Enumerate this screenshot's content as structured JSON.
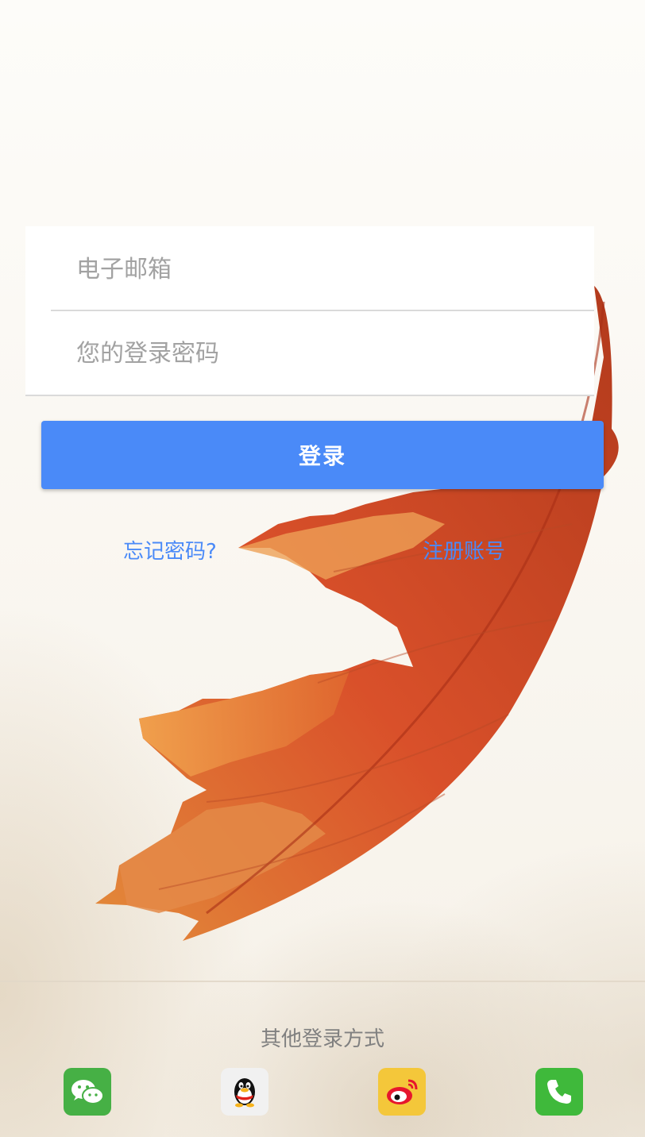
{
  "login_form": {
    "email_placeholder": "电子邮箱",
    "password_placeholder": "您的登录密码",
    "login_label": "登录"
  },
  "links": {
    "forgot_password": "忘记密码?",
    "register": "注册账号"
  },
  "other_login": {
    "title": "其他登录方式",
    "providers": [
      {
        "icon": "wechat-icon"
      },
      {
        "icon": "qq-icon"
      },
      {
        "icon": "weibo-icon"
      },
      {
        "icon": "phone-icon"
      }
    ]
  },
  "colors": {
    "accent": "#4a8af8",
    "wechat": "#46b045",
    "weibo": "#f4c73a",
    "phone": "#3fb93b"
  }
}
